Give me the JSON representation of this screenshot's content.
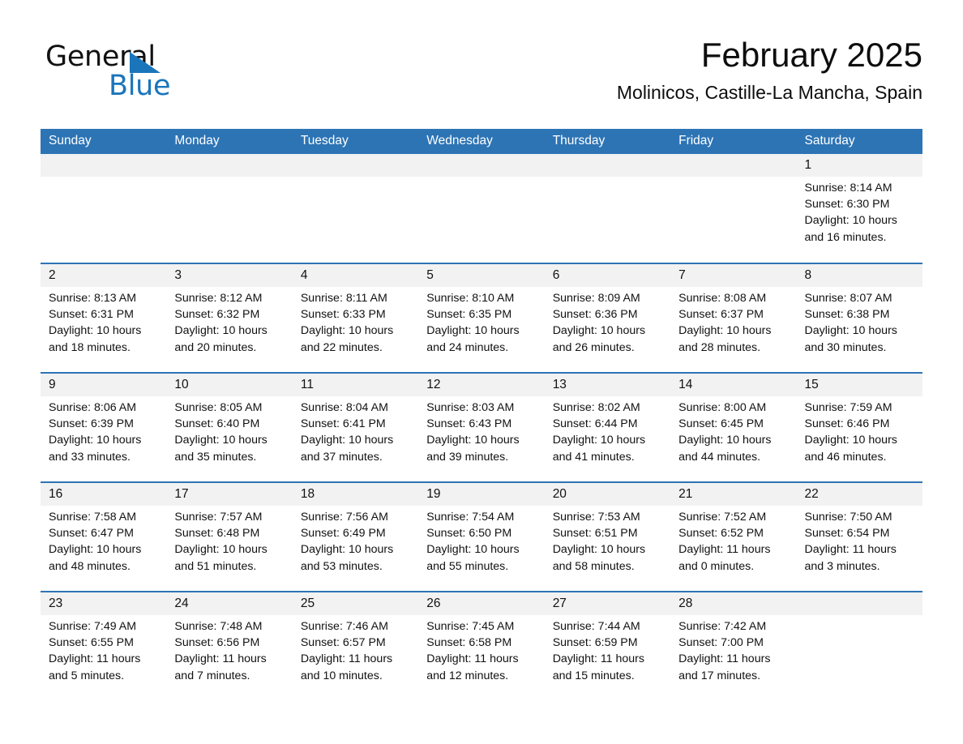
{
  "brand": {
    "name_part1": "General",
    "name_part2": "Blue",
    "triangle_color": "#1b75bb",
    "accent_color": "#2d74b5"
  },
  "header": {
    "title": "February 2025",
    "subtitle": "Molinicos, Castille-La Mancha, Spain"
  },
  "calendar": {
    "weekday_headers": [
      "Sunday",
      "Monday",
      "Tuesday",
      "Wednesday",
      "Thursday",
      "Friday",
      "Saturday"
    ],
    "weeks": [
      [
        {
          "day": "",
          "empty": true,
          "sunrise": "",
          "sunset": "",
          "daylight": ""
        },
        {
          "day": "",
          "empty": true,
          "sunrise": "",
          "sunset": "",
          "daylight": ""
        },
        {
          "day": "",
          "empty": true,
          "sunrise": "",
          "sunset": "",
          "daylight": ""
        },
        {
          "day": "",
          "empty": true,
          "sunrise": "",
          "sunset": "",
          "daylight": ""
        },
        {
          "day": "",
          "empty": true,
          "sunrise": "",
          "sunset": "",
          "daylight": ""
        },
        {
          "day": "",
          "empty": true,
          "sunrise": "",
          "sunset": "",
          "daylight": ""
        },
        {
          "day": "1",
          "empty": false,
          "sunrise": "Sunrise: 8:14 AM",
          "sunset": "Sunset: 6:30 PM",
          "daylight": "Daylight: 10 hours and 16 minutes."
        }
      ],
      [
        {
          "day": "2",
          "empty": false,
          "sunrise": "Sunrise: 8:13 AM",
          "sunset": "Sunset: 6:31 PM",
          "daylight": "Daylight: 10 hours and 18 minutes."
        },
        {
          "day": "3",
          "empty": false,
          "sunrise": "Sunrise: 8:12 AM",
          "sunset": "Sunset: 6:32 PM",
          "daylight": "Daylight: 10 hours and 20 minutes."
        },
        {
          "day": "4",
          "empty": false,
          "sunrise": "Sunrise: 8:11 AM",
          "sunset": "Sunset: 6:33 PM",
          "daylight": "Daylight: 10 hours and 22 minutes."
        },
        {
          "day": "5",
          "empty": false,
          "sunrise": "Sunrise: 8:10 AM",
          "sunset": "Sunset: 6:35 PM",
          "daylight": "Daylight: 10 hours and 24 minutes."
        },
        {
          "day": "6",
          "empty": false,
          "sunrise": "Sunrise: 8:09 AM",
          "sunset": "Sunset: 6:36 PM",
          "daylight": "Daylight: 10 hours and 26 minutes."
        },
        {
          "day": "7",
          "empty": false,
          "sunrise": "Sunrise: 8:08 AM",
          "sunset": "Sunset: 6:37 PM",
          "daylight": "Daylight: 10 hours and 28 minutes."
        },
        {
          "day": "8",
          "empty": false,
          "sunrise": "Sunrise: 8:07 AM",
          "sunset": "Sunset: 6:38 PM",
          "daylight": "Daylight: 10 hours and 30 minutes."
        }
      ],
      [
        {
          "day": "9",
          "empty": false,
          "sunrise": "Sunrise: 8:06 AM",
          "sunset": "Sunset: 6:39 PM",
          "daylight": "Daylight: 10 hours and 33 minutes."
        },
        {
          "day": "10",
          "empty": false,
          "sunrise": "Sunrise: 8:05 AM",
          "sunset": "Sunset: 6:40 PM",
          "daylight": "Daylight: 10 hours and 35 minutes."
        },
        {
          "day": "11",
          "empty": false,
          "sunrise": "Sunrise: 8:04 AM",
          "sunset": "Sunset: 6:41 PM",
          "daylight": "Daylight: 10 hours and 37 minutes."
        },
        {
          "day": "12",
          "empty": false,
          "sunrise": "Sunrise: 8:03 AM",
          "sunset": "Sunset: 6:43 PM",
          "daylight": "Daylight: 10 hours and 39 minutes."
        },
        {
          "day": "13",
          "empty": false,
          "sunrise": "Sunrise: 8:02 AM",
          "sunset": "Sunset: 6:44 PM",
          "daylight": "Daylight: 10 hours and 41 minutes."
        },
        {
          "day": "14",
          "empty": false,
          "sunrise": "Sunrise: 8:00 AM",
          "sunset": "Sunset: 6:45 PM",
          "daylight": "Daylight: 10 hours and 44 minutes."
        },
        {
          "day": "15",
          "empty": false,
          "sunrise": "Sunrise: 7:59 AM",
          "sunset": "Sunset: 6:46 PM",
          "daylight": "Daylight: 10 hours and 46 minutes."
        }
      ],
      [
        {
          "day": "16",
          "empty": false,
          "sunrise": "Sunrise: 7:58 AM",
          "sunset": "Sunset: 6:47 PM",
          "daylight": "Daylight: 10 hours and 48 minutes."
        },
        {
          "day": "17",
          "empty": false,
          "sunrise": "Sunrise: 7:57 AM",
          "sunset": "Sunset: 6:48 PM",
          "daylight": "Daylight: 10 hours and 51 minutes."
        },
        {
          "day": "18",
          "empty": false,
          "sunrise": "Sunrise: 7:56 AM",
          "sunset": "Sunset: 6:49 PM",
          "daylight": "Daylight: 10 hours and 53 minutes."
        },
        {
          "day": "19",
          "empty": false,
          "sunrise": "Sunrise: 7:54 AM",
          "sunset": "Sunset: 6:50 PM",
          "daylight": "Daylight: 10 hours and 55 minutes."
        },
        {
          "day": "20",
          "empty": false,
          "sunrise": "Sunrise: 7:53 AM",
          "sunset": "Sunset: 6:51 PM",
          "daylight": "Daylight: 10 hours and 58 minutes."
        },
        {
          "day": "21",
          "empty": false,
          "sunrise": "Sunrise: 7:52 AM",
          "sunset": "Sunset: 6:52 PM",
          "daylight": "Daylight: 11 hours and 0 minutes."
        },
        {
          "day": "22",
          "empty": false,
          "sunrise": "Sunrise: 7:50 AM",
          "sunset": "Sunset: 6:54 PM",
          "daylight": "Daylight: 11 hours and 3 minutes."
        }
      ],
      [
        {
          "day": "23",
          "empty": false,
          "sunrise": "Sunrise: 7:49 AM",
          "sunset": "Sunset: 6:55 PM",
          "daylight": "Daylight: 11 hours and 5 minutes."
        },
        {
          "day": "24",
          "empty": false,
          "sunrise": "Sunrise: 7:48 AM",
          "sunset": "Sunset: 6:56 PM",
          "daylight": "Daylight: 11 hours and 7 minutes."
        },
        {
          "day": "25",
          "empty": false,
          "sunrise": "Sunrise: 7:46 AM",
          "sunset": "Sunset: 6:57 PM",
          "daylight": "Daylight: 11 hours and 10 minutes."
        },
        {
          "day": "26",
          "empty": false,
          "sunrise": "Sunrise: 7:45 AM",
          "sunset": "Sunset: 6:58 PM",
          "daylight": "Daylight: 11 hours and 12 minutes."
        },
        {
          "day": "27",
          "empty": false,
          "sunrise": "Sunrise: 7:44 AM",
          "sunset": "Sunset: 6:59 PM",
          "daylight": "Daylight: 11 hours and 15 minutes."
        },
        {
          "day": "28",
          "empty": false,
          "sunrise": "Sunrise: 7:42 AM",
          "sunset": "Sunset: 7:00 PM",
          "daylight": "Daylight: 11 hours and 17 minutes."
        },
        {
          "day": "",
          "empty": true,
          "sunrise": "",
          "sunset": "",
          "daylight": ""
        }
      ]
    ]
  }
}
